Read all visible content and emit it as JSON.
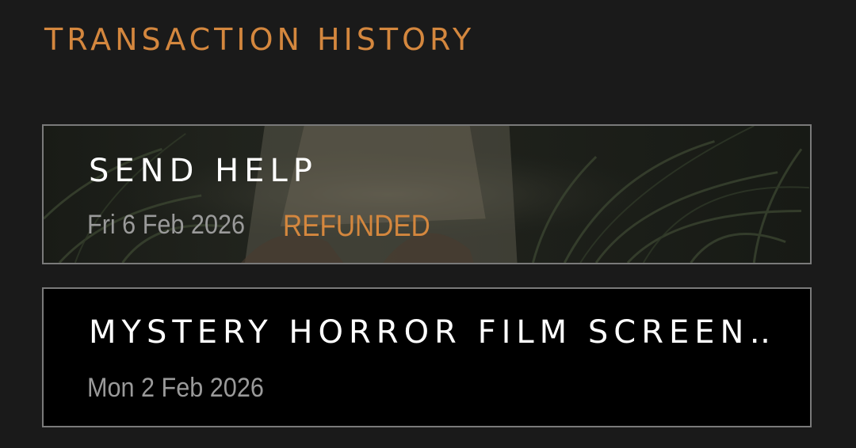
{
  "page": {
    "title": "TRANSACTION HISTORY"
  },
  "transactions": [
    {
      "title": "SEND HELP",
      "date": "Fri 6 Feb 2026",
      "status": "REFUNDED",
      "has_backdrop_image": true
    },
    {
      "title": "MYSTERY HORROR FILM SCREEN…",
      "date": "Mon 2 Feb 2026",
      "status": "",
      "has_backdrop_image": false
    }
  ],
  "colors": {
    "background": "#1a1a1a",
    "accent": "#d4873e",
    "card_border": "#7a7a7a",
    "date_text": "#9a9a9a",
    "title_text": "#ffffff"
  }
}
